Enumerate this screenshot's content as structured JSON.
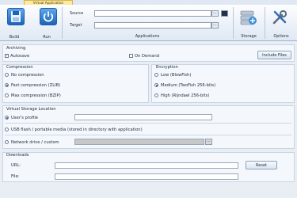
{
  "ribbon": {
    "tab_label": "Virtual Application",
    "build_label": "Build",
    "run_label": "Run",
    "source_label": "Source",
    "target_label": "Target",
    "applications_label": "Applications",
    "storage_label": "Storage",
    "options_label": "Options",
    "browse_icon_glyph": "⋯",
    "source_value": "",
    "target_value": ""
  },
  "archiving": {
    "title": "Archiving",
    "autosave_label": "Autosave",
    "on_demand_label": "On Demand",
    "include_files_label": "Include Files",
    "check_glyph": "✓"
  },
  "compression": {
    "title": "Compression",
    "options": [
      "No compression",
      "Fast compression (ZLIB)",
      "Max compression (BZIP)"
    ],
    "selected": "Fast compression (ZLIB)"
  },
  "encryption": {
    "title": "Encryption",
    "options": [
      "Low (BlowFish)",
      "Medium (TwoFish 256-bits)",
      "High (Rijndael 256-bits)"
    ],
    "selected": "Medium (TwoFish 256-bits)"
  },
  "storage": {
    "title": "Virtual Storage Location",
    "options": [
      "User's profile",
      "USB flash / portable media (stored in directory with application)",
      "Network drive / custom"
    ],
    "selected": "User's profile",
    "user_profile_value": "",
    "network_value": ""
  },
  "downloads": {
    "title": "Downloads",
    "url_label": "URL:",
    "file_label": "File:",
    "url_value": "",
    "file_value": "",
    "reset_label": "Reset"
  },
  "colors": {
    "accent": "#1c64b8",
    "panel_bg": "#f4f7fb",
    "window_bg": "#e9eef5",
    "tab_highlight": "#fbeaa0"
  }
}
